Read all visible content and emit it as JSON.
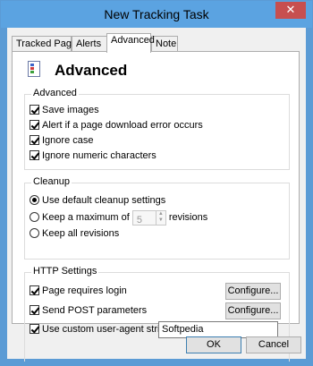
{
  "window": {
    "title": "New Tracking Task",
    "close_label": "✕"
  },
  "tabs": [
    {
      "label": "Tracked Page",
      "active": false
    },
    {
      "label": "Alerts",
      "active": false
    },
    {
      "label": "Advanced",
      "active": true
    },
    {
      "label": "Note",
      "active": false
    }
  ],
  "panel": {
    "icon": "document-list-icon",
    "heading": "Advanced"
  },
  "advanced_group": {
    "legend": "Advanced",
    "options": [
      {
        "label": "Save images",
        "checked": true
      },
      {
        "label": "Alert if a page download error occurs",
        "checked": true
      },
      {
        "label": "Ignore case",
        "checked": true
      },
      {
        "label": "Ignore numeric characters",
        "checked": true
      }
    ]
  },
  "cleanup_group": {
    "legend": "Cleanup",
    "default_label": "Use default cleanup settings",
    "max_label_before": "Keep a maximum of",
    "max_value": "5",
    "max_label_after": "revisions",
    "all_label": "Keep all revisions",
    "selected": "default"
  },
  "http_group": {
    "legend": "HTTP Settings",
    "login_label": "Page requires login",
    "login_checked": true,
    "post_label": "Send POST parameters",
    "post_checked": true,
    "ua_label": "Use custom user-agent string:",
    "ua_checked": true,
    "ua_value": "Softpedia",
    "configure_label": "Configure..."
  },
  "footer": {
    "ok_label": "OK",
    "cancel_label": "Cancel"
  },
  "colors": {
    "titlebar": "#5ba3e1",
    "close": "#c74f4f",
    "dialog_bg": "#f0f0f0"
  }
}
